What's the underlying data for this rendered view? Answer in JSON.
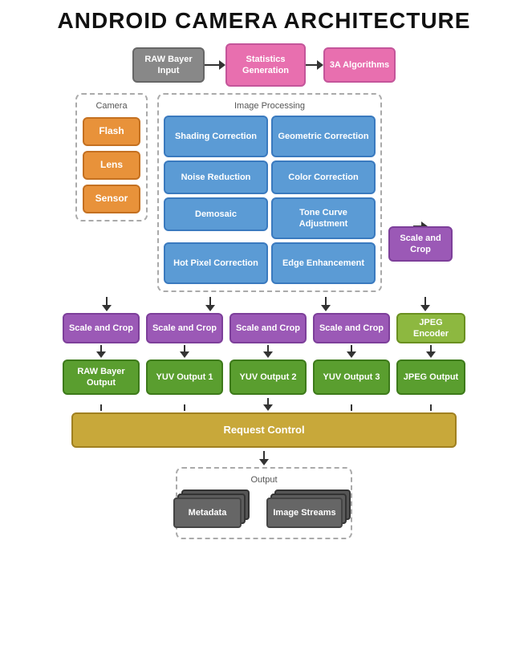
{
  "title": "ANDROID CAMERA ARCHITECTURE",
  "blocks": {
    "raw_bayer_input": "RAW Bayer Input",
    "statistics_generation": "Statistics Generation",
    "three_a_algorithms": "3A Algorithms",
    "camera_label": "Camera",
    "flash": "Flash",
    "lens": "Lens",
    "sensor": "Sensor",
    "image_processing_label": "Image Processing",
    "shading_correction": "Shading Correction",
    "geometric_correction": "Geometric Correction",
    "noise_reduction": "Noise Reduction",
    "color_correction": "Color Correction",
    "demosaic": "Demosaic",
    "tone_curve_adjustment": "Tone Curve Adjustment",
    "hot_pixel_correction": "Hot Pixel Correction",
    "edge_enhancement": "Edge Enhancement",
    "scale_and_crop_right": "Scale and Crop",
    "scale_and_crop_1": "Scale and Crop",
    "scale_and_crop_2": "Scale and Crop",
    "scale_and_crop_3": "Scale and Crop",
    "scale_and_crop_4": "Scale and Crop",
    "jpeg_encoder": "JPEG Encoder",
    "raw_bayer_output": "RAW Bayer Output",
    "yuv_output_1": "YUV Output 1",
    "yuv_output_2": "YUV Output 2",
    "yuv_output_3": "YUV Output 3",
    "jpeg_output": "JPEG Output",
    "request_control": "Request Control",
    "output_label": "Output",
    "metadata": "Metadata",
    "image_streams": "Image Streams"
  }
}
